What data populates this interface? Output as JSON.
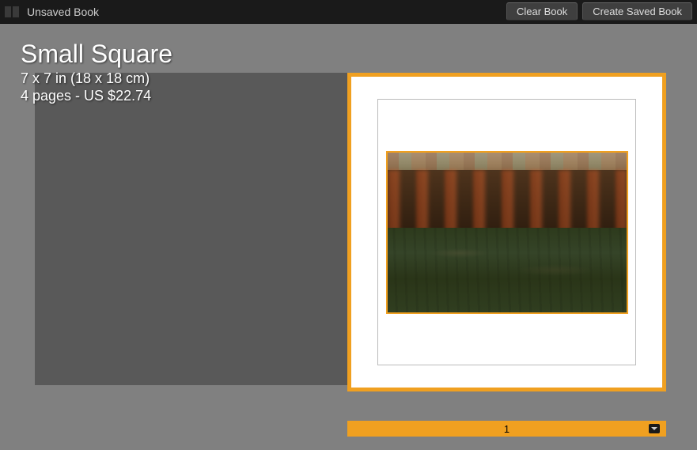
{
  "topbar": {
    "title": "Unsaved Book",
    "clear_label": "Clear Book",
    "create_label": "Create Saved Book"
  },
  "book": {
    "title": "Small Square",
    "dimensions": "7 x 7 in (18 x 18 cm)",
    "price_line": "4 pages - US $22.74"
  },
  "page": {
    "number": "1"
  },
  "colors": {
    "selection": "#f0a020",
    "gray_bg": "#808080"
  }
}
